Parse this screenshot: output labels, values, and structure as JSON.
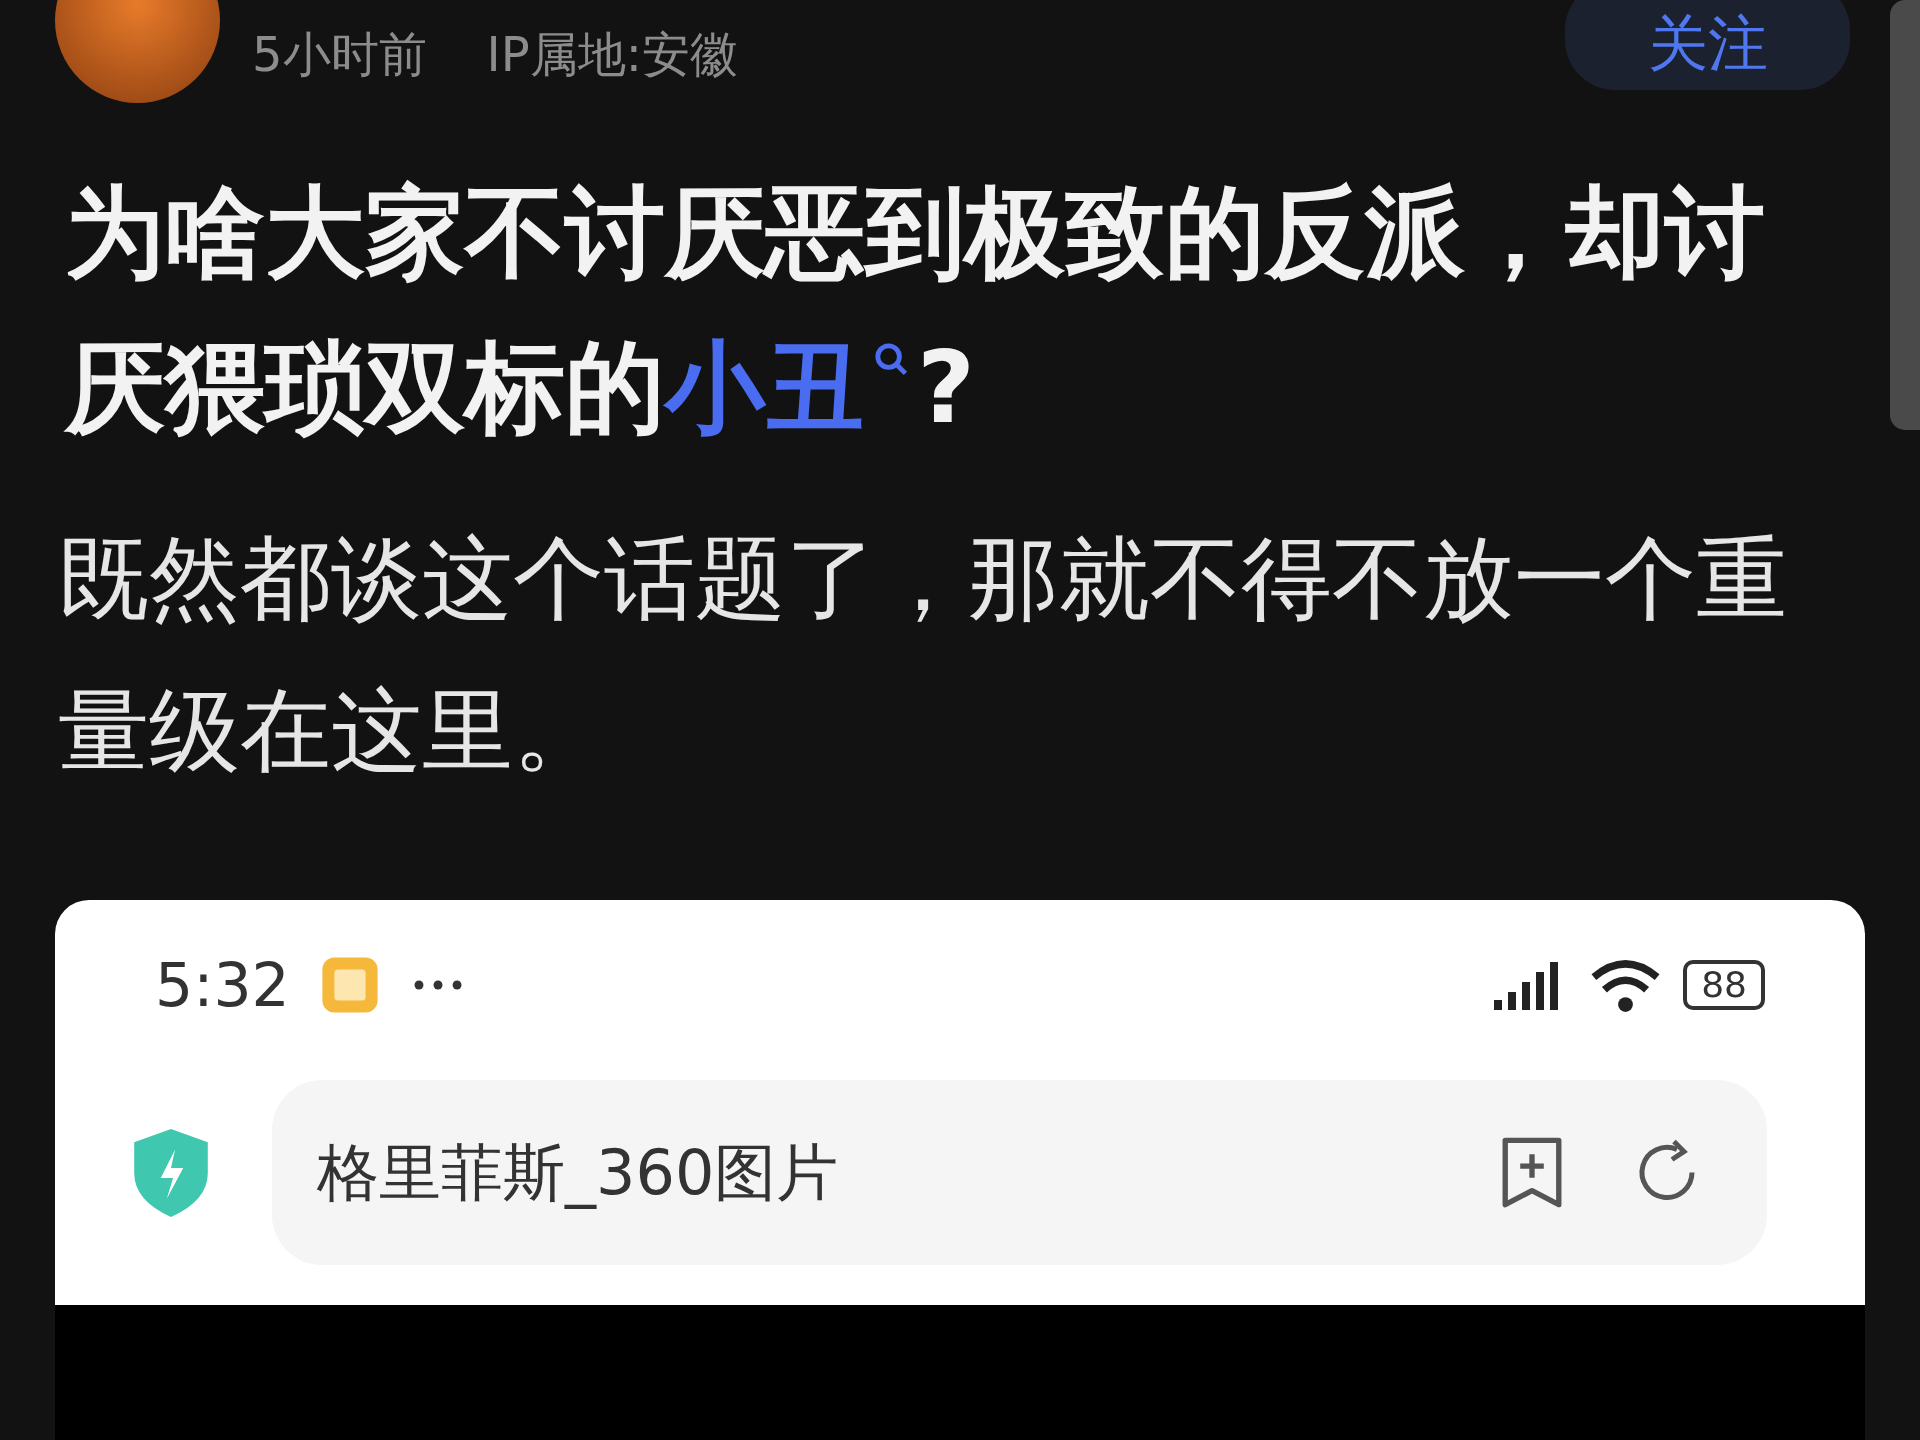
{
  "post": {
    "time": "5小时前",
    "ip_location": "IP属地:安徽",
    "follow_label": "关注",
    "title": {
      "before": "为啥大家不讨厌恶到极致的反派，却讨厌猥琐双标的",
      "keyword": "小丑",
      "after": "?"
    },
    "body": "既然都谈这个话题了，那就不得不放一个重量级在这里。"
  },
  "embedded_screenshot": {
    "status_time": "5:32",
    "battery": "88",
    "address": "格里菲斯_360图片"
  }
}
